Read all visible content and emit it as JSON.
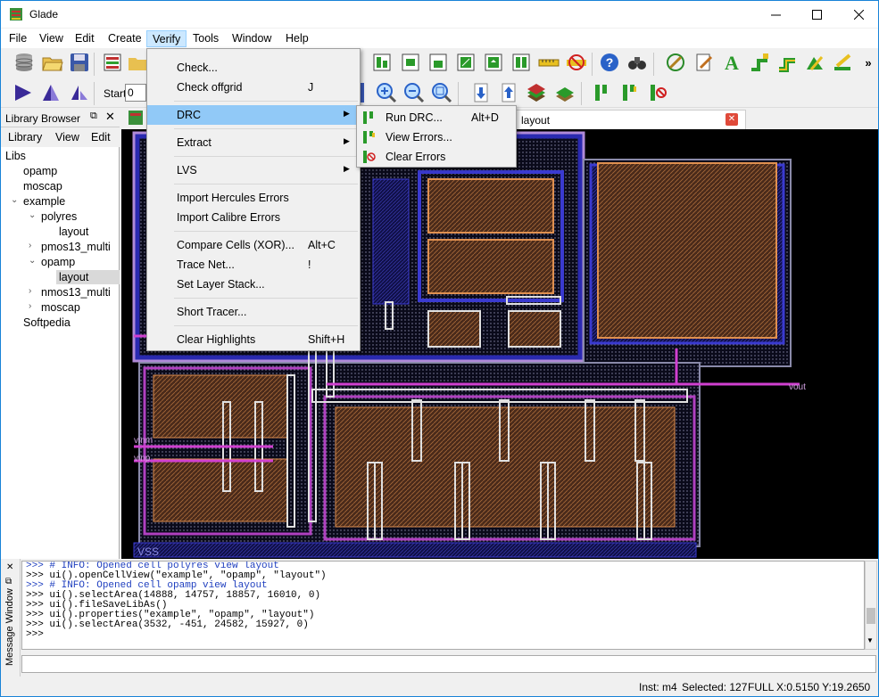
{
  "window": {
    "title": "Glade"
  },
  "menubar": [
    "File",
    "View",
    "Edit",
    "Create",
    "Verify",
    "Tools",
    "Window",
    "Help"
  ],
  "toolbar2": {
    "start_label": "Start",
    "start_value": "0"
  },
  "library": {
    "title": "Library Browser",
    "tabs": [
      "Library",
      "View",
      "Edit"
    ],
    "tree": [
      {
        "label": "Libs",
        "level": 0,
        "arrow": ""
      },
      {
        "label": "opamp",
        "level": 1,
        "arrow": ""
      },
      {
        "label": "moscap",
        "level": 1,
        "arrow": ""
      },
      {
        "label": "example",
        "level": 1,
        "arrow": "v"
      },
      {
        "label": "polyres",
        "level": 2,
        "arrow": "v"
      },
      {
        "label": "layout",
        "level": 3,
        "arrow": ""
      },
      {
        "label": "pmos13_multi",
        "level": 2,
        "arrow": ">"
      },
      {
        "label": "opamp",
        "level": 2,
        "arrow": "v"
      },
      {
        "label": "layout",
        "level": 3,
        "arrow": "",
        "selected": true
      },
      {
        "label": "nmos13_multi",
        "level": 2,
        "arrow": ">"
      },
      {
        "label": "moscap",
        "level": 2,
        "arrow": ">"
      },
      {
        "label": "Softpedia",
        "level": 1,
        "arrow": ""
      }
    ]
  },
  "doc_tab": {
    "label": "layout"
  },
  "verify_menu": {
    "items": [
      {
        "label": "Check...",
        "shortcut": ""
      },
      {
        "label": "Check offgrid",
        "shortcut": "J"
      },
      {
        "sep": true
      },
      {
        "label": "DRC",
        "shortcut": "",
        "submenu": true,
        "highlight": true
      },
      {
        "sep": true
      },
      {
        "label": "Extract",
        "shortcut": "",
        "submenu": true
      },
      {
        "sep": true
      },
      {
        "label": "LVS",
        "shortcut": "",
        "submenu": true
      },
      {
        "sep": true
      },
      {
        "label": "Import Hercules Errors",
        "shortcut": ""
      },
      {
        "label": "Import Calibre Errors",
        "shortcut": ""
      },
      {
        "sep": true
      },
      {
        "label": "Compare Cells (XOR)...",
        "shortcut": "Alt+C"
      },
      {
        "label": "Trace Net...",
        "shortcut": "!"
      },
      {
        "label": "Set Layer Stack...",
        "shortcut": ""
      },
      {
        "sep": true
      },
      {
        "label": "Short Tracer...",
        "shortcut": ""
      },
      {
        "sep": true
      },
      {
        "label": "Clear Highlights",
        "shortcut": "Shift+H"
      }
    ]
  },
  "drc_submenu": [
    {
      "label": "Run DRC...",
      "shortcut": "Alt+D"
    },
    {
      "label": "View Errors...",
      "shortcut": ""
    },
    {
      "label": "Clear Errors",
      "shortcut": ""
    }
  ],
  "layout_labels": {
    "vout": "vout",
    "vinm": "vinm",
    "vinp": "vinp",
    "vss": "VSS"
  },
  "message_window": {
    "title": "Message Window",
    "lines": [
      {
        "text": ">>> # INFO: Opened cell polyres view layout",
        "comment": true
      },
      {
        "text": ">>> ui().openCellView(\"example\", \"opamp\", \"layout\")",
        "comment": false
      },
      {
        "text": ">>> # INFO: Opened cell opamp view layout",
        "comment": true
      },
      {
        "text": ">>> ui().selectArea(14888, 14757, 18857, 16010, 0)",
        "comment": false
      },
      {
        "text": ">>> ui().fileSaveLibAs()",
        "comment": false
      },
      {
        "text": ">>> ui().properties(\"example\", \"opamp\", \"layout\")",
        "comment": false
      },
      {
        "text": ">>> ui().selectArea(3532, -451, 24582, 15927, 0)",
        "comment": false
      },
      {
        "text": ">>>",
        "comment": false
      }
    ]
  },
  "status": {
    "inst": "Inst: m4",
    "selected": "Selected: 127",
    "mode": "FULL",
    "coords": "X:0.5150 Y:19.2650"
  }
}
